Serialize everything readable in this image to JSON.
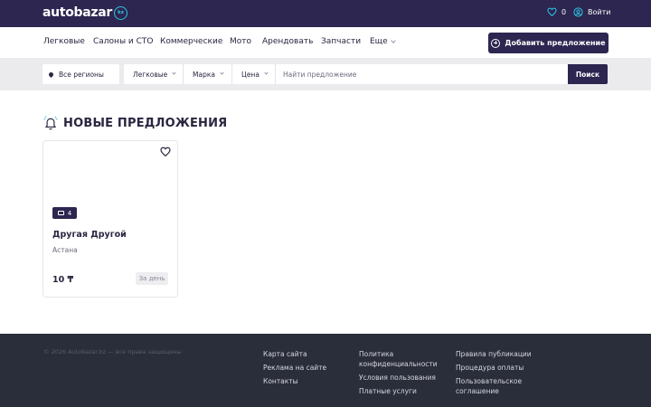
{
  "header": {
    "logo_text": "autobazar",
    "logo_badge": "kz",
    "favorites_count": "0",
    "login_label": "Войти"
  },
  "nav": {
    "items": [
      "Легковые",
      "Салоны и СТО",
      "Коммерческие",
      "Мото",
      "Арендовать",
      "Запчасти"
    ],
    "more_label": "Еще",
    "add_button_label": "Добавить предложение"
  },
  "search": {
    "region": "Все регионы",
    "category": "Легковые",
    "brand": "Марка",
    "price": "Цена",
    "query_placeholder": "Найти предложение",
    "button_label": "Поиск"
  },
  "section": {
    "title": "НОВЫЕ ПРЕДЛОЖЕНИЯ"
  },
  "listing": {
    "photo_count": "4",
    "title": "Другая Другой",
    "city": "Астана",
    "price": "10 ₸",
    "period": "За день"
  },
  "footer": {
    "copyright": "© 2026 Autobazar.kz — все права защищены",
    "col1": [
      "Карта сайта",
      "Реклама на сайте",
      "Контакты"
    ],
    "col2": [
      "Политика конфиденциальности",
      "Условия пользования",
      "Платные услуги"
    ],
    "col3": [
      "Правила публикации",
      "Процедура оплаты",
      "Пользовательское соглашение"
    ]
  },
  "colors": {
    "brand_dark": "#2c2650",
    "accent": "#2ec4e0",
    "footer_bg": "#2a2d3a"
  }
}
